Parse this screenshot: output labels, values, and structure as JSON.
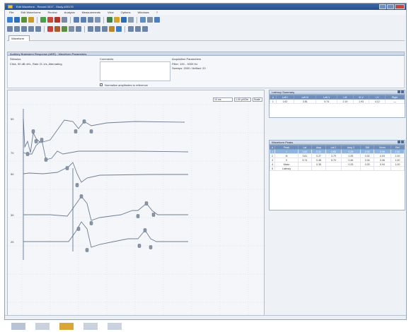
{
  "window": {
    "title": "Edit Waveform - Record 0017 - Study #20170"
  },
  "menu": [
    "File",
    "Edit Waveforms",
    "Review",
    "Analysis",
    "Measurements",
    "View",
    "Options",
    "Windows",
    "?"
  ],
  "toolbar_row1": [
    {
      "icon": "open-icon",
      "color": "#3b7fd0"
    },
    {
      "icon": "save-icon",
      "color": "#2f6fb8"
    },
    {
      "icon": "print-icon",
      "color": "#5b8f3a"
    },
    {
      "icon": "edit-icon",
      "color": "#c99a2a"
    },
    {
      "icon": "add-icon",
      "color": "#4aa04a"
    },
    {
      "icon": "remove-icon",
      "color": "#c94a3a"
    },
    {
      "icon": "marker-icon",
      "color": "#b0342c"
    },
    {
      "icon": "cursor-icon",
      "color": "#7a8aa3"
    },
    {
      "icon": "zoom-in-icon",
      "color": "#5a7fb0"
    },
    {
      "icon": "zoom-out-icon",
      "color": "#5a7fb0"
    },
    {
      "icon": "wave-icon",
      "color": "#6a85aa"
    },
    {
      "icon": "grid-icon",
      "color": "#7f95b3"
    },
    {
      "icon": "stack-icon",
      "color": "#3f7f4a"
    },
    {
      "icon": "folder-icon",
      "color": "#d2a52f"
    },
    {
      "icon": "measure-icon",
      "color": "#2c6db2"
    },
    {
      "icon": "chart-icon",
      "color": "#8a9ab0"
    },
    {
      "icon": "report-icon",
      "color": "#5f8fc0"
    },
    {
      "icon": "settings-icon",
      "color": "#7d8ea5"
    },
    {
      "icon": "help-icon",
      "color": "#4a7fc1"
    }
  ],
  "toolbar_row2": [
    {
      "icon": "trace-1-icon",
      "color": "#6b84a8"
    },
    {
      "icon": "trace-2-icon",
      "color": "#6b84a8"
    },
    {
      "icon": "trace-3-icon",
      "color": "#6b84a8"
    },
    {
      "icon": "trace-4-icon",
      "color": "#6b84a8"
    },
    {
      "icon": "trace-5-icon",
      "color": "#6b84a8"
    },
    {
      "icon": "peak-icon",
      "color": "#c6423a"
    },
    {
      "icon": "latency-icon",
      "color": "#a95c2e"
    },
    {
      "icon": "amplitude-icon",
      "color": "#5a8e44"
    },
    {
      "icon": "filter-icon",
      "color": "#7f8ea3"
    },
    {
      "icon": "average-icon",
      "color": "#6b84a8"
    },
    {
      "icon": "invert-icon",
      "color": "#6b84a8"
    },
    {
      "icon": "split-icon",
      "color": "#6b84a8"
    },
    {
      "icon": "merge-icon",
      "color": "#6b84a8"
    },
    {
      "icon": "compare-icon",
      "color": "#b8862f"
    },
    {
      "icon": "export-icon",
      "color": "#3c7cc4"
    },
    {
      "icon": "print-preview-icon",
      "color": "#6b84a8"
    },
    {
      "icon": "table-icon",
      "color": "#6b84a8"
    },
    {
      "icon": "note-icon",
      "color": "#6b84a8"
    }
  ],
  "tab": {
    "label": "Waveform"
  },
  "info": {
    "header": "Auditory Brainstem Response (ABR) - Waveform Parameters",
    "stimulus_label": "Stimulus",
    "stimulus_value": "Click, 90 dB nHL, Rate 21.1/s, Alternating",
    "comments_label": "Comments",
    "acq_label": "Acquisition Parameters",
    "acq_line1": "Filter: 100 - 3000 Hz",
    "acq_line2": "Sweeps: 2000 / Artifact: 20",
    "checkbox_label": "Normalize amplitudes to reference"
  },
  "trace_toolbar": [
    "10 ms",
    "1.00 µV/Div",
    "Scale"
  ],
  "trace_labels": [
    "90",
    "70",
    "50",
    "30",
    "20"
  ],
  "panel1": {
    "title": "Latency Summary",
    "headers": [
      "#",
      "Left I",
      "Left III",
      "Left V",
      "I-III",
      "III-V",
      "I-V",
      "Right"
    ],
    "rows": [
      [
        "1",
        "1.62",
        "3.81",
        "5.74",
        "2.19",
        "1.93",
        "4.12",
        "—"
      ]
    ]
  },
  "panel2": {
    "title": "Waveform Peaks",
    "headers": [
      "#",
      "Peak",
      "Lat",
      "Amp",
      "Lat 2",
      "Amp 2",
      "Diff",
      "Norm",
      "Ref"
    ],
    "rows": [
      [
        "1",
        "I",
        "1.62",
        "0.31",
        "1.60",
        "0.29",
        "0.02",
        "0.94",
        "1.00"
      ],
      [
        "2",
        "III",
        "3.81",
        "0.27",
        "3.79",
        "0.25",
        "0.02",
        "0.93",
        "1.00"
      ],
      [
        "3",
        "V",
        "5.74",
        "0.48",
        "5.70",
        "0.46",
        "0.04",
        "0.96",
        "1.00"
      ],
      [
        "4",
        "Mean",
        "",
        "0.35",
        "",
        "0.33",
        "0.03",
        "0.94",
        "1.00"
      ],
      [
        "5",
        "Latency",
        "",
        "",
        "",
        "",
        "",
        "",
        ""
      ]
    ],
    "selected_row": 0
  },
  "taskbar": [
    {
      "icon": "taskbar-app-1-icon",
      "color": "#b7c4d6"
    },
    {
      "icon": "taskbar-app-2-icon",
      "color": "#c9d2de"
    },
    {
      "icon": "taskbar-app-3-icon",
      "color": "#d9a63a"
    },
    {
      "icon": "taskbar-app-4-icon",
      "color": "#c9d2de"
    },
    {
      "icon": "taskbar-app-5-icon",
      "color": "#c9d2de"
    }
  ]
}
